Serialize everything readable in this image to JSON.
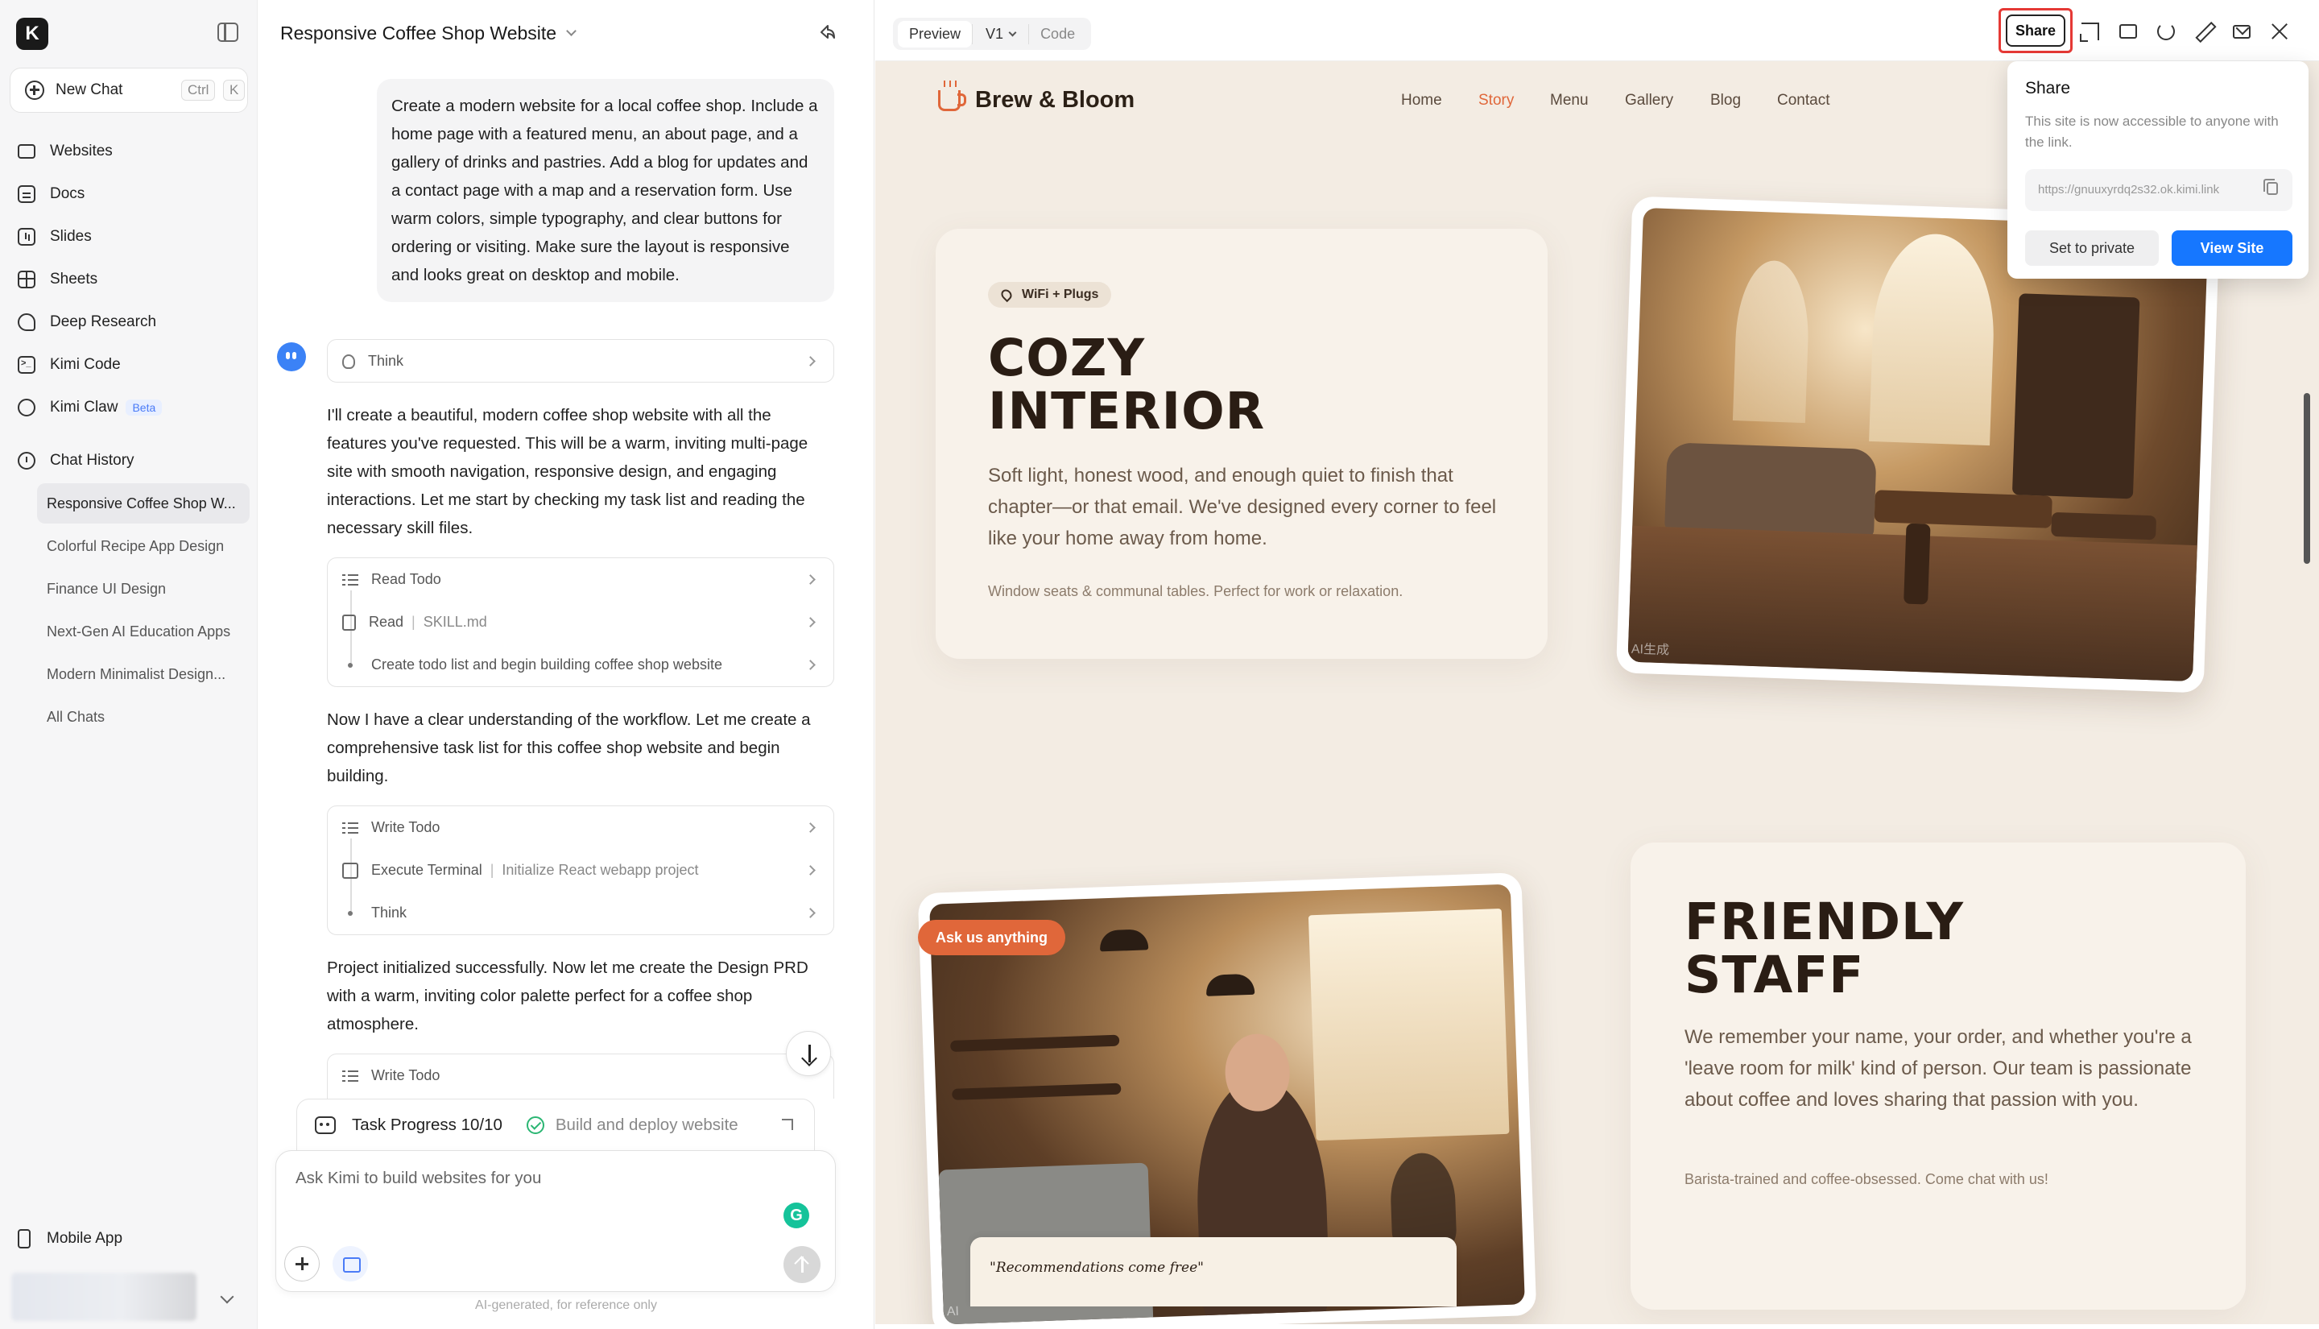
{
  "sidebar": {
    "logo": "K",
    "new_chat": {
      "label": "New Chat",
      "shortcut_ctrl": "Ctrl",
      "shortcut_key": "K"
    },
    "nav": [
      {
        "label": "Websites",
        "icon": "monitor-icon"
      },
      {
        "label": "Docs",
        "icon": "document-icon"
      },
      {
        "label": "Slides",
        "icon": "slides-icon"
      },
      {
        "label": "Sheets",
        "icon": "sheets-icon"
      },
      {
        "label": "Deep Research",
        "icon": "research-icon"
      },
      {
        "label": "Kimi Code",
        "icon": "terminal-icon"
      },
      {
        "label": "Kimi Claw",
        "icon": "claw-icon",
        "badge": "Beta"
      }
    ],
    "chat_history": {
      "label": "Chat History",
      "items": [
        "Responsive Coffee Shop W...",
        "Colorful Recipe App Design",
        "Finance UI Design",
        "Next-Gen AI Education Apps",
        "Modern Minimalist Design...",
        "All Chats"
      ]
    },
    "mobile_app": "Mobile App"
  },
  "chat": {
    "title": "Responsive Coffee Shop Website",
    "user_message": "Create a modern website for a local coffee shop. Include a home page with a featured menu, an about page, and a gallery of drinks and pastries. Add a blog for updates and a contact page with a map and a reservation form. Use warm colors, simple typography, and clear buttons for ordering or visiting. Make sure the layout is responsive and looks great on desktop and mobile.",
    "think_label": "Think",
    "assistant_1": "I'll create a beautiful, modern coffee shop website with all the features you've requested. This will be a warm, inviting multi-page site with smooth navigation, responsive design, and engaging interactions. Let me start by checking my task list and reading the necessary skill files.",
    "tools_1": [
      {
        "label": "Read Todo",
        "sub": ""
      },
      {
        "label": "Read",
        "sub": "SKILL.md"
      },
      {
        "label": "Create todo list and begin building coffee shop website",
        "sub": ""
      }
    ],
    "assistant_2": "Now I have a clear understanding of the workflow. Let me create a comprehensive task list for this coffee shop website and begin building.",
    "tools_2": [
      {
        "label": "Write Todo",
        "sub": ""
      },
      {
        "label": "Execute Terminal",
        "sub": "Initialize React webapp project"
      },
      {
        "label": "Think",
        "sub": ""
      }
    ],
    "assistant_3": "Project initialized successfully. Now let me create the Design PRD with a warm, inviting color palette perfect for a coffee shop atmosphere.",
    "tools_3": [
      {
        "label": "Write Todo"
      }
    ],
    "task_progress": "Task Progress 10/10",
    "task_current": "Build and deploy website",
    "input_placeholder": "Ask Kimi to build websites for you",
    "disclaimer": "AI-generated, for reference only"
  },
  "preview": {
    "tabs": {
      "preview": "Preview",
      "version": "V1",
      "code": "Code"
    },
    "share_label": "Share",
    "share_popover": {
      "title": "Share",
      "description": "This site is now accessible to anyone with the link.",
      "link": "https://gnuuxyrdq2s32.ok.kimi.link",
      "private_label": "Set to private",
      "view_label": "View Site"
    },
    "site": {
      "brand": "Brew & Bloom",
      "nav": [
        "Home",
        "Story",
        "Menu",
        "Gallery",
        "Blog",
        "Contact"
      ],
      "active_nav": "Story",
      "section1": {
        "tag": "WiFi + Plugs",
        "title_line1": "COZY",
        "title_line2": "INTERIOR",
        "body": "Soft light, honest wood, and enough quiet to finish that chapter—or that email. We've designed every corner to feel like your home away from home.",
        "note": "Window seats & communal tables. Perfect for work or relaxation.",
        "photo_mark": "AI生成"
      },
      "section2": {
        "tag": "Ask us anything",
        "title_line1": "FRIENDLY",
        "title_line2": "STAFF",
        "body": "We remember your name, your order, and whether you're a 'leave room for milk' kind of person. Our team is passionate about coffee and loves sharing that passion with you.",
        "note": "Barista-trained and coffee-obsessed. Come chat with us!",
        "quote": "\"Recommendations come free\"",
        "photo_mark": "AI"
      }
    }
  },
  "colors": {
    "accent": "#e0673a",
    "site_bg": "#f3ece3",
    "primary_button": "#1677ff",
    "highlight": "#e53935"
  }
}
